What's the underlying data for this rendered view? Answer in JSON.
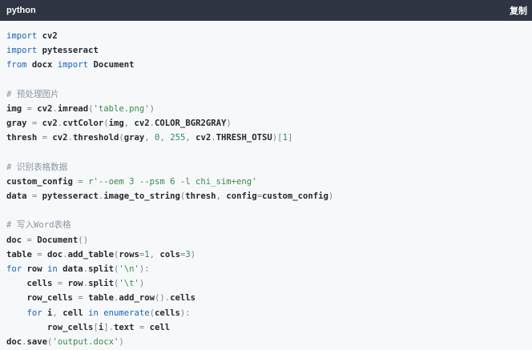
{
  "header": {
    "language": "python",
    "copy_label": "复制"
  },
  "code": {
    "lines": [
      [
        {
          "t": "import",
          "c": "kw"
        },
        {
          "t": " cv2",
          "c": "nm"
        }
      ],
      [
        {
          "t": "import",
          "c": "kw"
        },
        {
          "t": " pytesseract",
          "c": "nm"
        }
      ],
      [
        {
          "t": "from",
          "c": "kw"
        },
        {
          "t": " docx ",
          "c": "nm"
        },
        {
          "t": "import",
          "c": "kw"
        },
        {
          "t": " Document",
          "c": "nm"
        }
      ],
      [],
      [
        {
          "t": "# 预处理图片",
          "c": "cm"
        }
      ],
      [
        {
          "t": "img ",
          "c": "nm"
        },
        {
          "t": "=",
          "c": "pn"
        },
        {
          "t": " cv2",
          "c": "nm"
        },
        {
          "t": ".",
          "c": "pn"
        },
        {
          "t": "imread",
          "c": "nm"
        },
        {
          "t": "(",
          "c": "pn"
        },
        {
          "t": "'table.png'",
          "c": "str"
        },
        {
          "t": ")",
          "c": "pn"
        }
      ],
      [
        {
          "t": "gray ",
          "c": "nm"
        },
        {
          "t": "=",
          "c": "pn"
        },
        {
          "t": " cv2",
          "c": "nm"
        },
        {
          "t": ".",
          "c": "pn"
        },
        {
          "t": "cvtColor",
          "c": "nm"
        },
        {
          "t": "(",
          "c": "pn"
        },
        {
          "t": "img",
          "c": "nm"
        },
        {
          "t": ", ",
          "c": "pn"
        },
        {
          "t": "cv2",
          "c": "nm"
        },
        {
          "t": ".",
          "c": "pn"
        },
        {
          "t": "COLOR_BGR2GRAY",
          "c": "nm"
        },
        {
          "t": ")",
          "c": "pn"
        }
      ],
      [
        {
          "t": "thresh ",
          "c": "nm"
        },
        {
          "t": "=",
          "c": "pn"
        },
        {
          "t": " cv2",
          "c": "nm"
        },
        {
          "t": ".",
          "c": "pn"
        },
        {
          "t": "threshold",
          "c": "nm"
        },
        {
          "t": "(",
          "c": "pn"
        },
        {
          "t": "gray",
          "c": "nm"
        },
        {
          "t": ", ",
          "c": "pn"
        },
        {
          "t": "0",
          "c": "num"
        },
        {
          "t": ", ",
          "c": "pn"
        },
        {
          "t": "255",
          "c": "num"
        },
        {
          "t": ", ",
          "c": "pn"
        },
        {
          "t": "cv2",
          "c": "nm"
        },
        {
          "t": ".",
          "c": "pn"
        },
        {
          "t": "THRESH_OTSU",
          "c": "nm"
        },
        {
          "t": ")[",
          "c": "pn"
        },
        {
          "t": "1",
          "c": "num"
        },
        {
          "t": "]",
          "c": "pn"
        }
      ],
      [],
      [
        {
          "t": "# 识别表格数据",
          "c": "cm"
        }
      ],
      [
        {
          "t": "custom_config ",
          "c": "nm"
        },
        {
          "t": "=",
          "c": "pn"
        },
        {
          "t": " r'--oem 3 --psm 6 -l chi_sim+eng'",
          "c": "str"
        }
      ],
      [
        {
          "t": "data ",
          "c": "nm"
        },
        {
          "t": "=",
          "c": "pn"
        },
        {
          "t": " pytesseract",
          "c": "nm"
        },
        {
          "t": ".",
          "c": "pn"
        },
        {
          "t": "image_to_string",
          "c": "nm"
        },
        {
          "t": "(",
          "c": "pn"
        },
        {
          "t": "thresh",
          "c": "nm"
        },
        {
          "t": ", ",
          "c": "pn"
        },
        {
          "t": "config",
          "c": "nm"
        },
        {
          "t": "=",
          "c": "pn"
        },
        {
          "t": "custom_config",
          "c": "nm"
        },
        {
          "t": ")",
          "c": "pn"
        }
      ],
      [],
      [
        {
          "t": "# 写入Word表格",
          "c": "cm"
        }
      ],
      [
        {
          "t": "doc ",
          "c": "nm"
        },
        {
          "t": "=",
          "c": "pn"
        },
        {
          "t": " Document",
          "c": "nm"
        },
        {
          "t": "()",
          "c": "pn"
        }
      ],
      [
        {
          "t": "table ",
          "c": "nm"
        },
        {
          "t": "=",
          "c": "pn"
        },
        {
          "t": " doc",
          "c": "nm"
        },
        {
          "t": ".",
          "c": "pn"
        },
        {
          "t": "add_table",
          "c": "nm"
        },
        {
          "t": "(",
          "c": "pn"
        },
        {
          "t": "rows",
          "c": "nm"
        },
        {
          "t": "=",
          "c": "pn"
        },
        {
          "t": "1",
          "c": "num"
        },
        {
          "t": ", ",
          "c": "pn"
        },
        {
          "t": "cols",
          "c": "nm"
        },
        {
          "t": "=",
          "c": "pn"
        },
        {
          "t": "3",
          "c": "num"
        },
        {
          "t": ")",
          "c": "pn"
        }
      ],
      [
        {
          "t": "for",
          "c": "kw"
        },
        {
          "t": " row ",
          "c": "nm"
        },
        {
          "t": "in",
          "c": "kw"
        },
        {
          "t": " data",
          "c": "nm"
        },
        {
          "t": ".",
          "c": "pn"
        },
        {
          "t": "split",
          "c": "nm"
        },
        {
          "t": "(",
          "c": "pn"
        },
        {
          "t": "'\\n'",
          "c": "str"
        },
        {
          "t": "):",
          "c": "pn"
        }
      ],
      [
        {
          "t": "    cells ",
          "c": "nm"
        },
        {
          "t": "=",
          "c": "pn"
        },
        {
          "t": " row",
          "c": "nm"
        },
        {
          "t": ".",
          "c": "pn"
        },
        {
          "t": "split",
          "c": "nm"
        },
        {
          "t": "(",
          "c": "pn"
        },
        {
          "t": "'\\t'",
          "c": "str"
        },
        {
          "t": ")",
          "c": "pn"
        }
      ],
      [
        {
          "t": "    row_cells ",
          "c": "nm"
        },
        {
          "t": "=",
          "c": "pn"
        },
        {
          "t": " table",
          "c": "nm"
        },
        {
          "t": ".",
          "c": "pn"
        },
        {
          "t": "add_row",
          "c": "nm"
        },
        {
          "t": "().",
          "c": "pn"
        },
        {
          "t": "cells",
          "c": "nm"
        }
      ],
      [
        {
          "t": "    ",
          "c": "nm"
        },
        {
          "t": "for",
          "c": "kw"
        },
        {
          "t": " i",
          "c": "nm"
        },
        {
          "t": ", ",
          "c": "pn"
        },
        {
          "t": "cell ",
          "c": "nm"
        },
        {
          "t": "in",
          "c": "kw"
        },
        {
          "t": " enumerate",
          "c": "kw"
        },
        {
          "t": "(",
          "c": "pn"
        },
        {
          "t": "cells",
          "c": "nm"
        },
        {
          "t": "):",
          "c": "pn"
        }
      ],
      [
        {
          "t": "        row_cells",
          "c": "nm"
        },
        {
          "t": "[",
          "c": "pn"
        },
        {
          "t": "i",
          "c": "nm"
        },
        {
          "t": "].",
          "c": "pn"
        },
        {
          "t": "text ",
          "c": "nm"
        },
        {
          "t": "=",
          "c": "pn"
        },
        {
          "t": " cell",
          "c": "nm"
        }
      ],
      [
        {
          "t": "doc",
          "c": "nm"
        },
        {
          "t": ".",
          "c": "pn"
        },
        {
          "t": "save",
          "c": "nm"
        },
        {
          "t": "(",
          "c": "pn"
        },
        {
          "t": "'output.docx'",
          "c": "str"
        },
        {
          "t": ")",
          "c": "pn"
        }
      ]
    ]
  }
}
